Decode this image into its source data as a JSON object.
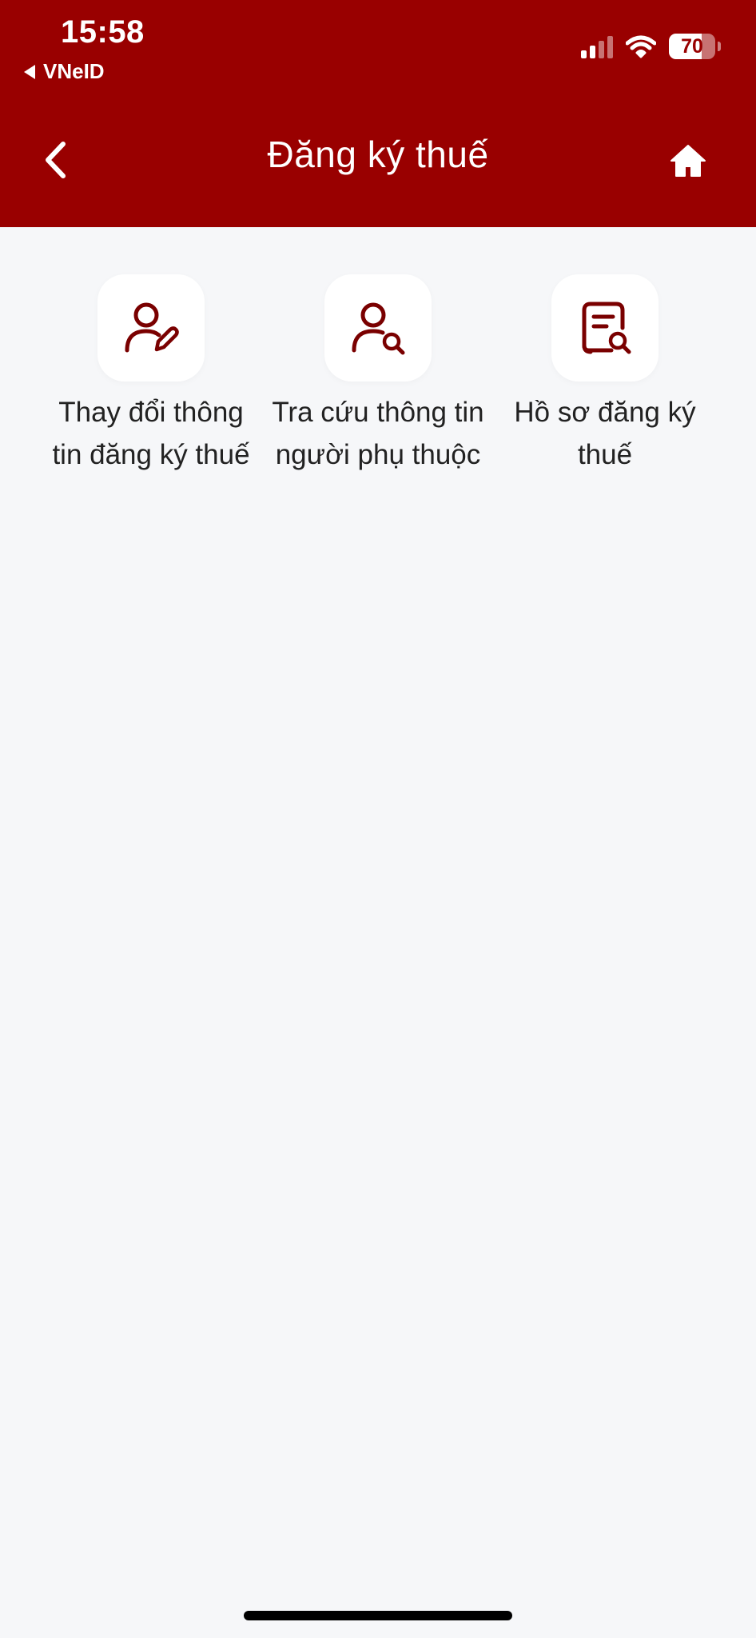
{
  "colors": {
    "header_bg": "#990000",
    "page_bg": "#f6f7f9",
    "icon_color": "#7a0000",
    "tile_bg": "#ffffff"
  },
  "status_bar": {
    "time": "15:58",
    "back_app": "VNeID",
    "battery": "70",
    "battery_level_pct": 70,
    "icons": [
      "signal-icon",
      "wifi-icon",
      "battery-icon"
    ]
  },
  "nav": {
    "title": "Đăng ký thuế",
    "back_icon": "chevron-left-icon",
    "home_icon": "home-icon"
  },
  "menu": {
    "items": [
      {
        "label": "Thay đổi thông tin đăng ký thuế",
        "icon": "user-edit-icon"
      },
      {
        "label": "Tra cứu thông tin người phụ thuộc",
        "icon": "user-search-icon"
      },
      {
        "label": "Hồ sơ đăng ký thuế",
        "icon": "document-search-icon"
      }
    ]
  }
}
